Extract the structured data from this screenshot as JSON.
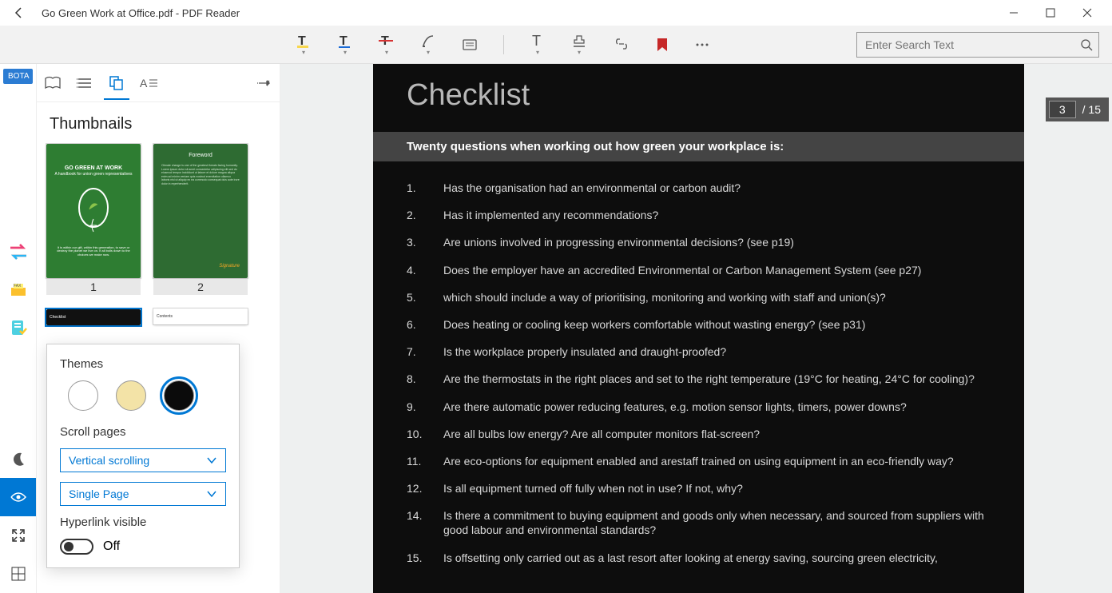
{
  "titlebar": {
    "title": "Go Green Work at Office.pdf - PDF Reader"
  },
  "rail": {
    "tag": "BOTA"
  },
  "sidebar": {
    "title": "Thumbnails",
    "thumbs": [
      {
        "num": "1",
        "title": "GO GREEN AT WORK",
        "sub": "A handbook for union green representatives"
      },
      {
        "num": "2",
        "title": "Foreword",
        "sub": ""
      }
    ]
  },
  "popup": {
    "themes_label": "Themes",
    "scroll_label": "Scroll pages",
    "scroll_sel1": "Vertical scrolling",
    "scroll_sel2": "Single Page",
    "hyperlink_label": "Hyperlink visible",
    "toggle_state": "Off"
  },
  "search": {
    "placeholder": "Enter Search Text"
  },
  "doc": {
    "heading": "Checklist",
    "subtitle": "Twenty questions when working out how green your workplace is:",
    "questions": [
      {
        "n": "1.",
        "t": "Has the organisation had an environmental or carbon audit?"
      },
      {
        "n": "2.",
        "t": "Has it implemented any recommendations?"
      },
      {
        "n": "3.",
        "t": "Are unions involved in progressing environmental decisions? (see p19)"
      },
      {
        "n": "4.",
        "t": "Does the employer have an accredited Environmental or Carbon Management System (see p27)"
      },
      {
        "n": "5.",
        "t": "which should include a way of prioritising, monitoring and working with staff and union(s)?"
      },
      {
        "n": "6.",
        "t": "Does heating or cooling keep workers comfortable without wasting energy? (see p31)"
      },
      {
        "n": "7.",
        "t": "Is the workplace properly insulated and draught-proofed?"
      },
      {
        "n": "8.",
        "t": "Are the thermostats in the right places and set to the right temperature (19°C for heating, 24°C for cooling)?"
      },
      {
        "n": "9.",
        "t": "Are there automatic power reducing features, e.g. motion sensor lights, timers, power downs?"
      },
      {
        "n": "10.",
        "t": "Are all bulbs low energy? Are all computer monitors flat-screen?"
      },
      {
        "n": "11.",
        "t": "Are eco-options for equipment enabled and arestaff trained on using equipment in an eco-friendly way?"
      },
      {
        "n": "12.",
        "t": "Is all equipment turned off fully when not in use? If not, why?"
      },
      {
        "n": "14.",
        "t": "Is there a commitment to buying equipment and goods only when necessary, and sourced from suppliers with good labour and environmental standards?"
      },
      {
        "n": "15.",
        "t": "Is offsetting only carried out as a last resort after looking at energy saving, sourcing green electricity,"
      }
    ]
  },
  "page_ind": {
    "current": "3",
    "total": "/ 15"
  }
}
